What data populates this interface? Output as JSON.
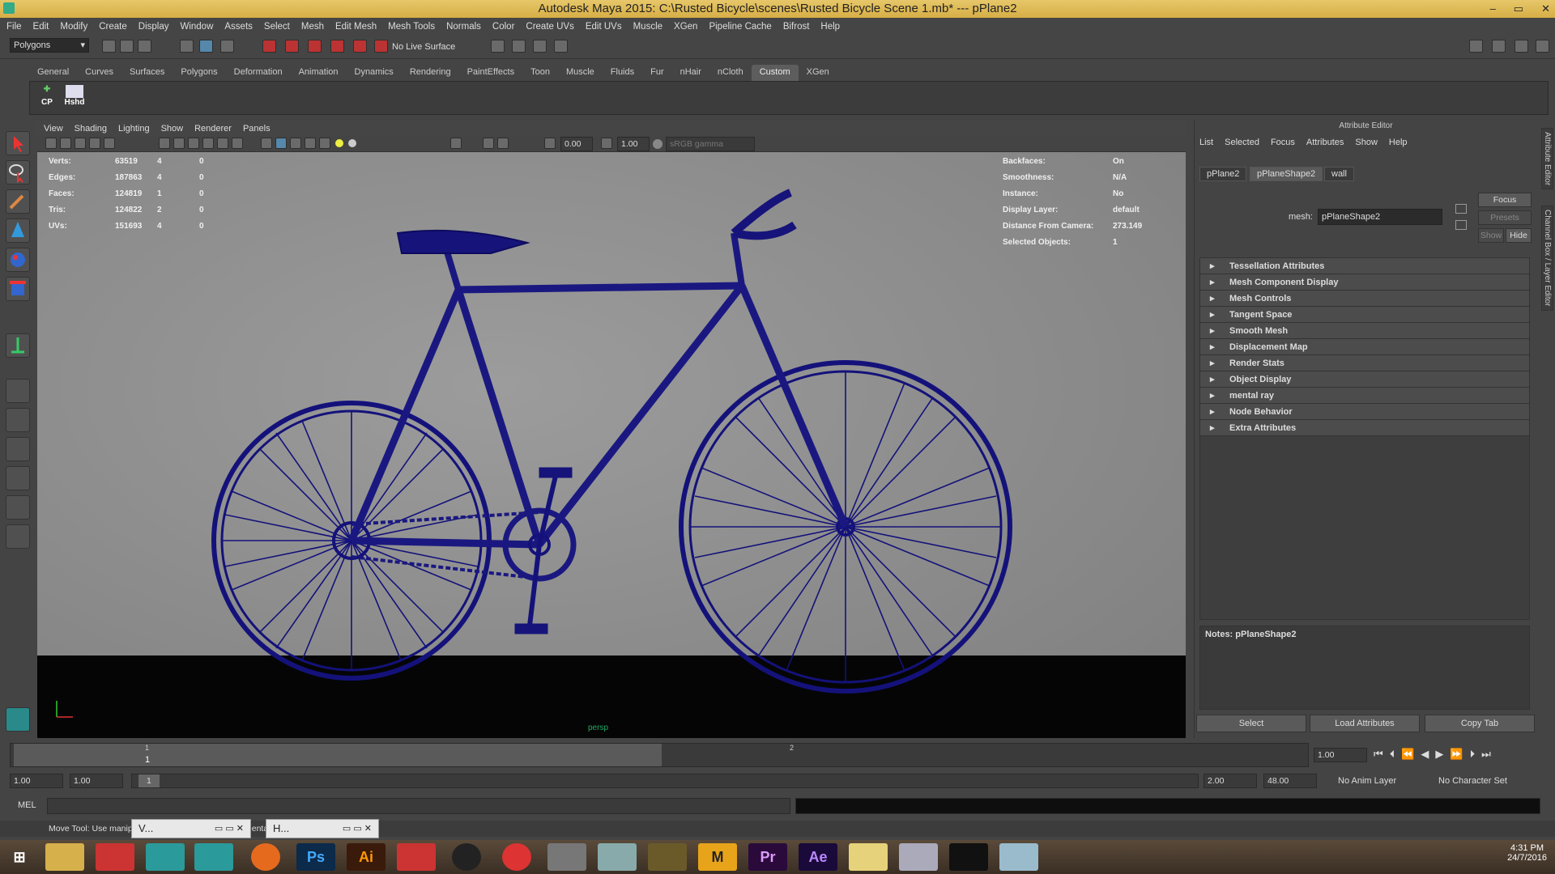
{
  "window": {
    "title": "Autodesk Maya 2015: C:\\Rusted Bicycle\\scenes\\Rusted Bicycle Scene 1.mb*   ---   pPlane2",
    "minimize": "–",
    "maximize": "▭",
    "close": "✕"
  },
  "menus": [
    "File",
    "Edit",
    "Modify",
    "Create",
    "Display",
    "Window",
    "Assets",
    "Select",
    "Mesh",
    "Edit Mesh",
    "Mesh Tools",
    "Normals",
    "Color",
    "Create UVs",
    "Edit UVs",
    "Muscle",
    "XGen",
    "Pipeline Cache",
    "Bifrost",
    "Help"
  ],
  "statusline": {
    "menuset": "Polygons",
    "live_surface": "No Live Surface"
  },
  "shelf": {
    "tabs": [
      "General",
      "Curves",
      "Surfaces",
      "Polygons",
      "Deformation",
      "Animation",
      "Dynamics",
      "Rendering",
      "PaintEffects",
      "Toon",
      "Muscle",
      "Fluids",
      "Fur",
      "nHair",
      "nCloth",
      "Custom",
      "XGen"
    ],
    "active_tab": "Custom",
    "items": [
      "CP",
      "Hshd"
    ]
  },
  "viewport": {
    "menus": [
      "View",
      "Shading",
      "Lighting",
      "Show",
      "Renderer",
      "Panels"
    ],
    "exposure": "0.00",
    "gamma": "1.00",
    "colorspace": "sRGB gamma",
    "camera": "persp",
    "hud_left": [
      {
        "label": "Verts:",
        "v1": "63519",
        "v2": "4",
        "v3": "0"
      },
      {
        "label": "Edges:",
        "v1": "187863",
        "v2": "4",
        "v3": "0"
      },
      {
        "label": "Faces:",
        "v1": "124819",
        "v2": "1",
        "v3": "0"
      },
      {
        "label": "Tris:",
        "v1": "124822",
        "v2": "2",
        "v3": "0"
      },
      {
        "label": "UVs:",
        "v1": "151693",
        "v2": "4",
        "v3": "0"
      }
    ],
    "hud_right": [
      {
        "label": "Backfaces:",
        "value": "On"
      },
      {
        "label": "Smoothness:",
        "value": "N/A"
      },
      {
        "label": "Instance:",
        "value": "No"
      },
      {
        "label": "Display Layer:",
        "value": "default"
      },
      {
        "label": "Distance From Camera:",
        "value": "273.149"
      },
      {
        "label": "Selected Objects:",
        "value": "1"
      }
    ]
  },
  "attribute_editor": {
    "title": "Attribute Editor",
    "menus": [
      "List",
      "Selected",
      "Focus",
      "Attributes",
      "Show",
      "Help"
    ],
    "tabs": [
      "pPlane2",
      "pPlaneShape2",
      "wall"
    ],
    "active_tab": "pPlaneShape2",
    "mesh_label": "mesh:",
    "mesh_value": "pPlaneShape2",
    "focus_btn": "Focus",
    "presets_btn": "Presets",
    "show_btn": "Show",
    "hide_btn": "Hide",
    "sections": [
      "Tessellation Attributes",
      "Mesh Component Display",
      "Mesh Controls",
      "Tangent Space",
      "Smooth Mesh",
      "Displacement Map",
      "Render Stats",
      "Object Display",
      "mental ray",
      "Node Behavior",
      "Extra Attributes"
    ],
    "notes_label": "Notes:  pPlaneShape2",
    "select_btn": "Select",
    "load_btn": "Load Attributes",
    "copy_btn": "Copy Tab"
  },
  "side_tabs": [
    "Attribute Editor",
    "Channel Box / Layer Editor"
  ],
  "time": {
    "tick1": "1",
    "tick2": "2",
    "marker": "1",
    "current": "1.00",
    "start": "1.00",
    "start2": "1.00",
    "range_val": "1",
    "end": "2.00",
    "end2": "48.00",
    "anim_layer": "No Anim Layer",
    "char_set": "No Character Set"
  },
  "cmdline": {
    "label": "MEL"
  },
  "helpline": "Move Tool: Use manipulator to move object(s). ... s orientation.",
  "popups": [
    {
      "label": "V..."
    },
    {
      "label": "H..."
    }
  ],
  "taskbar": {
    "apps": [
      "start",
      "explorer",
      "autodesk",
      "maya",
      "maya",
      "firefox",
      "Ps",
      "Ai",
      "autodesk",
      "unity",
      "s",
      "tool",
      "mine",
      "app",
      "M",
      "Pr",
      "Ae",
      "folder",
      "viewer",
      "cmd",
      "eraser"
    ],
    "time": "4:31 PM",
    "date": "24/7/2016"
  }
}
